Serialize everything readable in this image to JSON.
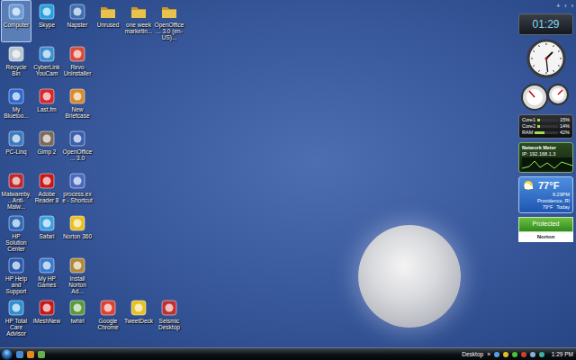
{
  "desktop": {
    "icon_rows": [
      [
        {
          "label": "Computer",
          "selected": true
        },
        {
          "label": "Skype",
          "selected": false
        },
        {
          "label": "Napster",
          "selected": false
        },
        {
          "label": "Unrused",
          "selected": false
        },
        {
          "label": "one week marketin...",
          "selected": false
        },
        {
          "label": "OpenOffice... 3.0 (en-US)...",
          "selected": false
        }
      ],
      [
        {
          "label": "Recycle Bin",
          "selected": false
        },
        {
          "label": "CyberLink YouCam",
          "selected": false
        },
        {
          "label": "Revo Uninstaller",
          "selected": false
        }
      ],
      [
        {
          "label": "My Bluetoo...",
          "selected": false
        },
        {
          "label": "Last.fm",
          "selected": false
        },
        {
          "label": "New Briefcase",
          "selected": false
        }
      ],
      [
        {
          "label": "PC-Linq",
          "selected": false
        },
        {
          "label": "Gimp 2",
          "selected": false
        },
        {
          "label": "OpenOffice... 3.0",
          "selected": false
        }
      ],
      [
        {
          "label": "Malwareby... Anti-Malw...",
          "selected": false
        },
        {
          "label": "Adobe Reader 8",
          "selected": false
        },
        {
          "label": "process.exe - Shortcut",
          "selected": false
        }
      ],
      [
        {
          "label": "HP Solution Center",
          "selected": false
        },
        {
          "label": "Safari",
          "selected": false
        },
        {
          "label": "Norton 360",
          "selected": false
        }
      ],
      [
        {
          "label": "HP Help and Support",
          "selected": false
        },
        {
          "label": "My HP Games",
          "selected": false
        },
        {
          "label": "Install Norton Ad...",
          "selected": false
        }
      ],
      [
        {
          "label": "HP Total Care Advisor",
          "selected": false
        },
        {
          "label": "iMeshNew",
          "selected": false
        },
        {
          "label": "twhirl",
          "selected": false
        },
        {
          "label": "Google Chrome",
          "selected": false
        },
        {
          "label": "TweetDeck",
          "selected": false
        },
        {
          "label": "Seismic Desktop",
          "selected": false
        }
      ]
    ]
  },
  "sidebar": {
    "controls": [
      "+",
      "‹",
      "›"
    ],
    "digital_clock": "01:29",
    "cpu_meter": [
      {
        "name": "Core1",
        "reading": "15%",
        "level": 0.15
      },
      {
        "name": "Core2",
        "reading": "14%",
        "level": 0.14
      },
      {
        "name": "RAM",
        "reading": "42%",
        "level": 0.42
      }
    ],
    "network_meter": {
      "title": "Network Meter",
      "ip": "IP: 192.168.1.3"
    },
    "weather": {
      "temp": "77°F",
      "time": "6:29PM",
      "city": "Providence, RI",
      "high": "79°F",
      "day": "Today"
    },
    "norton": {
      "status": "Protected",
      "brand": "Norton"
    }
  },
  "taskbar": {
    "toolbar": "Desktop",
    "chevron": "»",
    "clock": "1:29 PM"
  }
}
